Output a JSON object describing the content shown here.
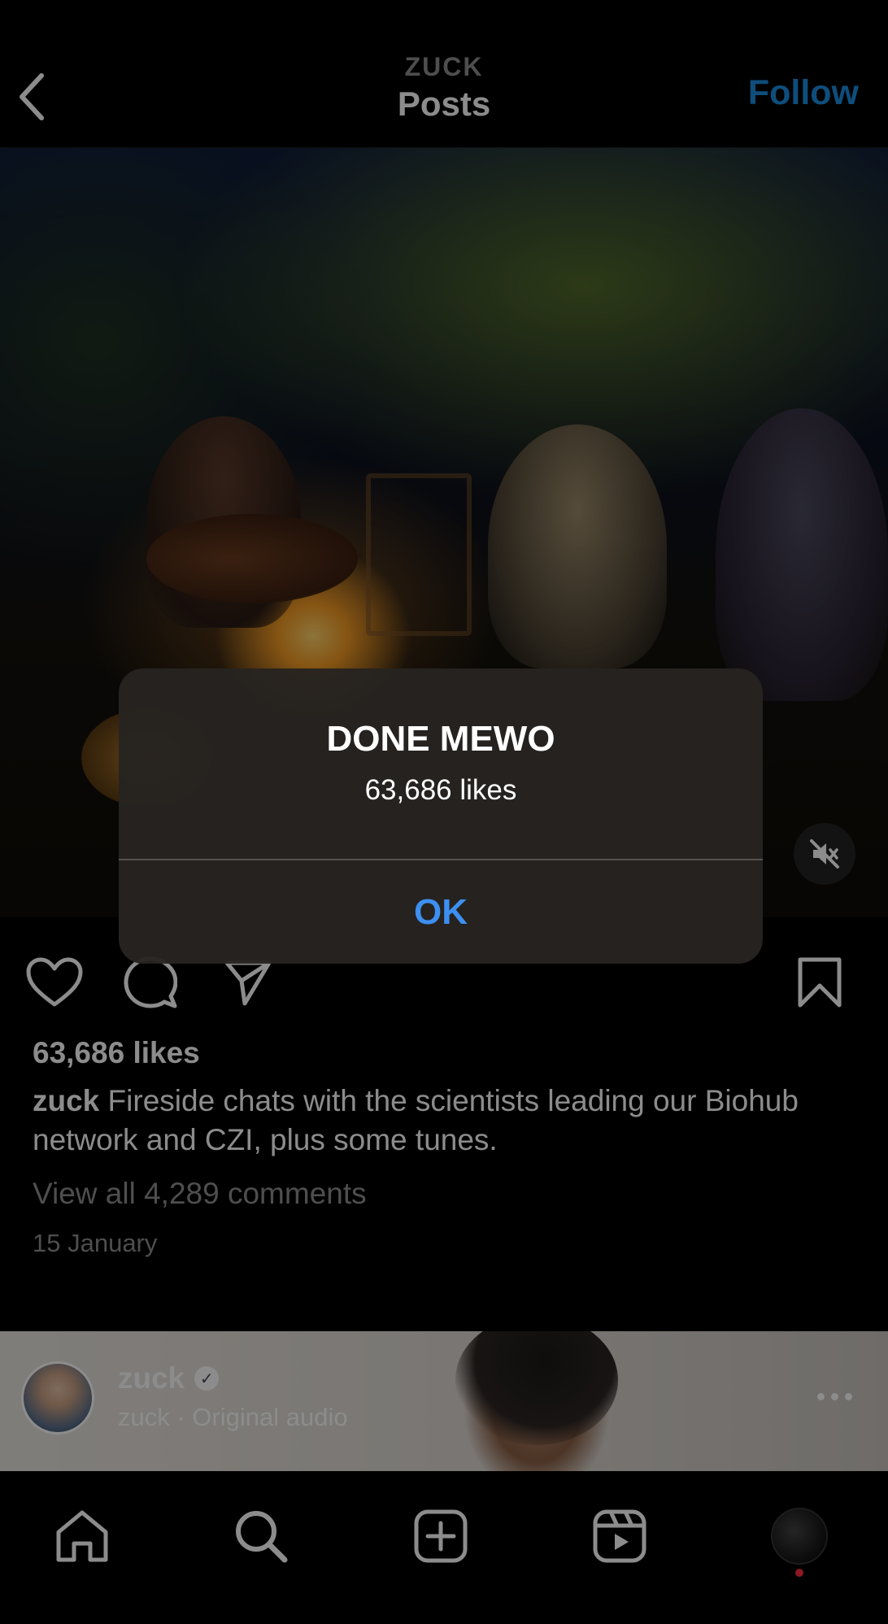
{
  "header": {
    "username": "ZUCK",
    "title": "Posts",
    "follow_label": "Follow"
  },
  "post": {
    "likes": "63,686 likes",
    "caption_user": "zuck",
    "caption_text": " Fireside chats with the scientists leading our Biohub network and CZI, plus some tunes.",
    "view_comments": "View all 4,289 comments",
    "date": "15 January",
    "muted": true
  },
  "next_post": {
    "username": "zuck",
    "audio": "zuck · Original audio"
  },
  "alert": {
    "title": "DONE MEWO",
    "message": "63,686 likes",
    "ok_label": "OK"
  },
  "icons": {
    "back": "chevron-left-icon",
    "like": "heart-icon",
    "comment": "comment-icon",
    "share": "paper-plane-icon",
    "save": "bookmark-icon",
    "mute": "speaker-muted-icon",
    "home": "home-icon",
    "search": "search-icon",
    "create": "plus-square-icon",
    "reels": "reels-icon"
  },
  "colors": {
    "follow": "#1a8fe3",
    "alert_button": "#3d8ff0",
    "notification_dot": "#ff2d3d"
  }
}
